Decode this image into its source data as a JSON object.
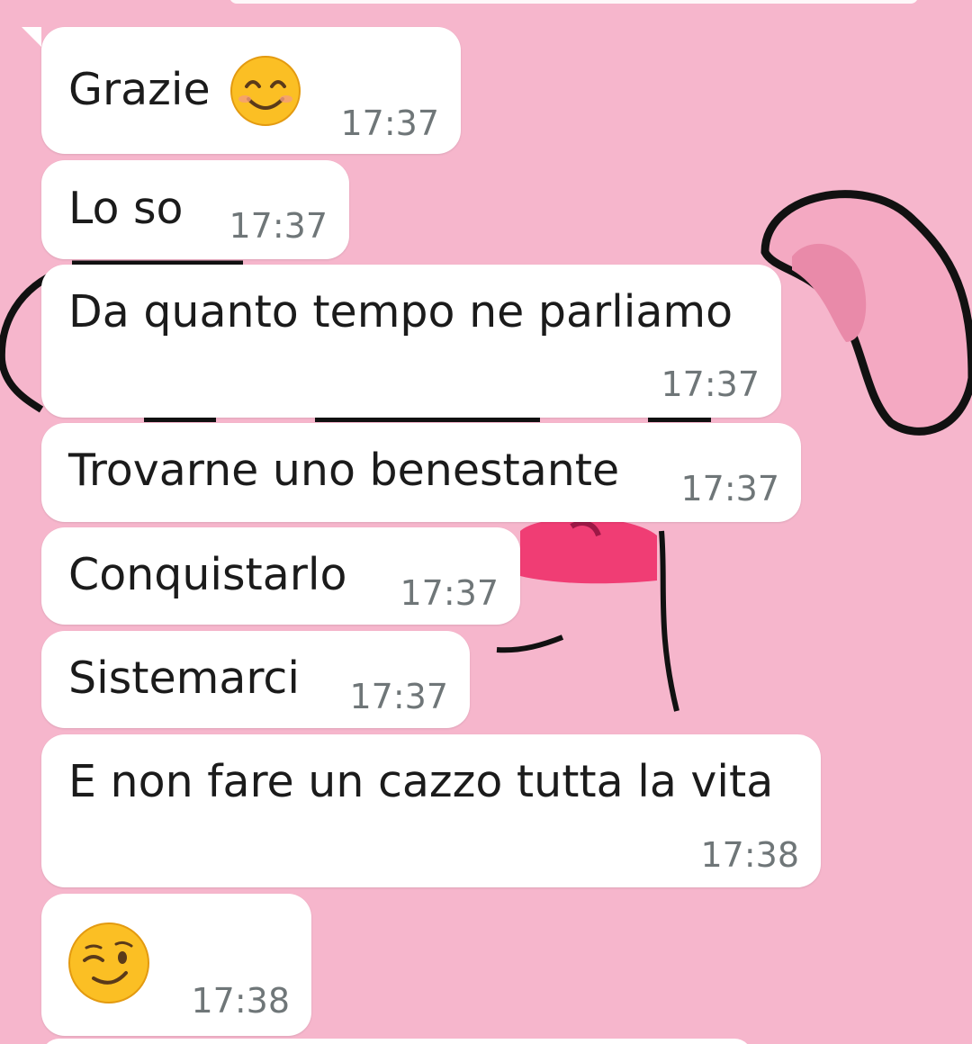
{
  "chat": {
    "messages": [
      {
        "text": "Grazie",
        "emoji": "smiling-face-icon",
        "time": "17:37"
      },
      {
        "text": "Lo so",
        "time": "17:37"
      },
      {
        "text": "Da quanto tempo ne parliamo",
        "time": "17:37"
      },
      {
        "text": "Trovarne uno benestante",
        "time": "17:37"
      },
      {
        "text": "Conquistarlo",
        "time": "17:37"
      },
      {
        "text": "Sistemarci",
        "time": "17:37"
      },
      {
        "text": "E non fare un cazzo tutta la vita",
        "time": "17:38"
      },
      {
        "text": "",
        "emoji": "winking-face-icon",
        "time": "17:38"
      }
    ]
  },
  "colors": {
    "wallpaper": "#f6b6cc",
    "bubble": "#ffffff",
    "text": "#1b1b1b",
    "timestamp": "#6f7678",
    "emoji": "#fbbf24"
  }
}
